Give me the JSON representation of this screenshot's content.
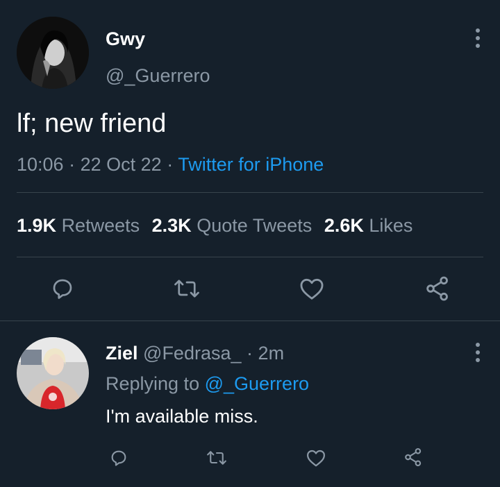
{
  "tweet": {
    "author_name": "Gwy",
    "author_handle": "@_Guerrero",
    "text": "lf; new friend",
    "time": "10:06",
    "date": "22 Oct 22",
    "separator": "·",
    "source": "Twitter for iPhone",
    "stats": {
      "retweets_count": "1.9K",
      "retweets_label": "Retweets",
      "quotes_count": "2.3K",
      "quotes_label": "Quote Tweets",
      "likes_count": "2.6K",
      "likes_label": "Likes"
    }
  },
  "reply": {
    "author_name": "Ziel",
    "author_handle": "@Fedrasa_",
    "separator": "·",
    "age": "2m",
    "replying_prefix": "Replying to",
    "replying_to": "@_Guerrero",
    "text": "I'm available miss."
  },
  "icons": [
    "reply-icon",
    "retweet-icon",
    "like-icon",
    "share-icon",
    "more-icon"
  ],
  "colors": {
    "background": "#15202b",
    "text": "#ffffff",
    "muted": "#8b98a5",
    "link": "#1d9bf0",
    "divider": "#38444d"
  }
}
